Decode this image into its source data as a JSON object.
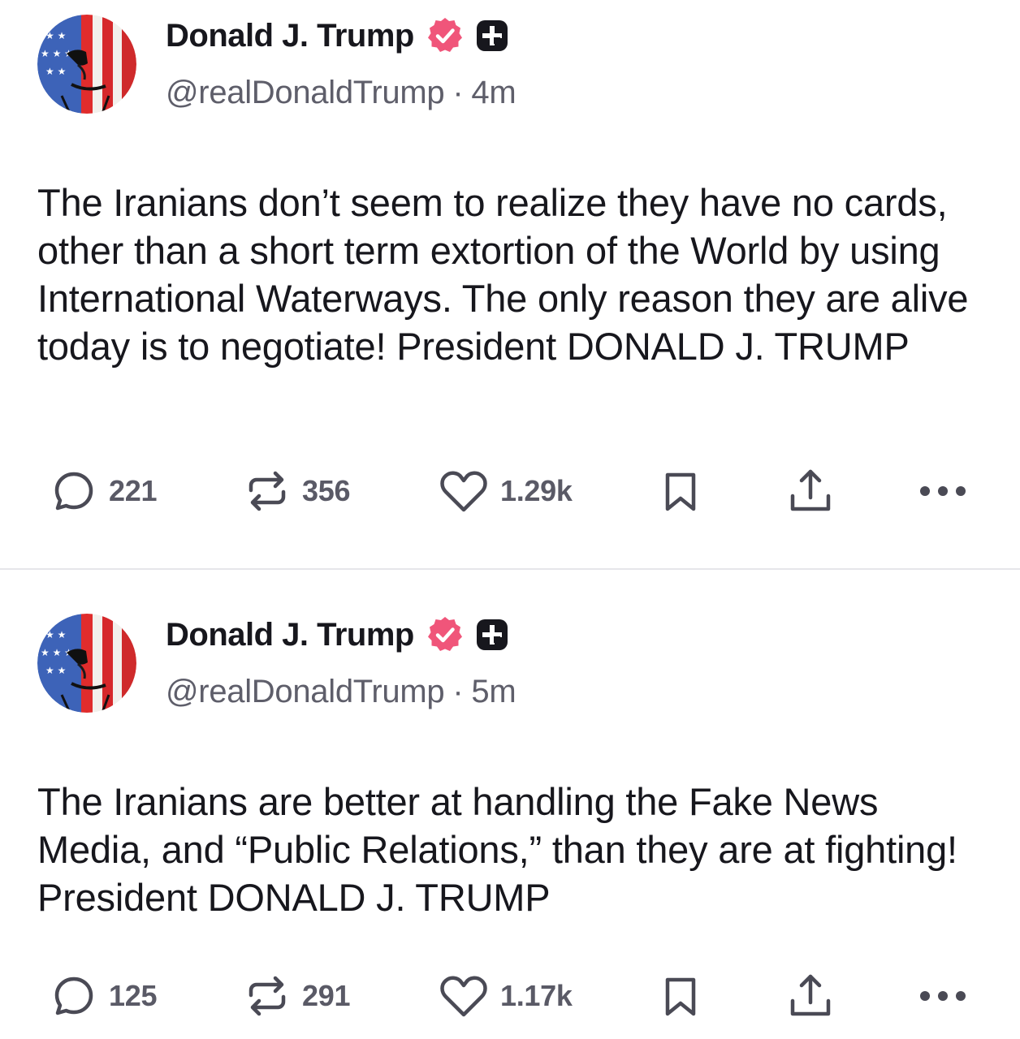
{
  "posts": [
    {
      "author": {
        "display_name": "Donald J. Trump",
        "handle": "@realDonaldTrump",
        "verified_icon": "verified-badge-icon",
        "plus_icon": "plus-badge-icon"
      },
      "separator": "·",
      "time": "4m",
      "text": "The Iranians don’t seem to realize they have no cards, other than a short term extortion of the World by using International Waterways. The only reason they are alive today is to negotiate! President DONALD J. TRUMP",
      "stats": {
        "replies": "221",
        "reposts": "356",
        "likes": "1.29k"
      }
    },
    {
      "author": {
        "display_name": "Donald J. Trump",
        "handle": "@realDonaldTrump",
        "verified_icon": "verified-badge-icon",
        "plus_icon": "plus-badge-icon"
      },
      "separator": "·",
      "time": "5m",
      "text": "The Iranians are better at handling the Fake News Media, and “Public Relations,” than they are at fighting! President DONALD J. TRUMP",
      "stats": {
        "replies": "125",
        "reposts": "291",
        "likes": "1.17k"
      }
    }
  ],
  "icons": [
    "reply-icon",
    "repost-icon",
    "like-icon",
    "bookmark-icon",
    "share-icon",
    "more-icon"
  ],
  "colors": {
    "verified": "#f0557a",
    "text": "#17171d",
    "muted": "#5e5e6a",
    "icon": "#4a4a55",
    "divider": "#e6e6ea"
  }
}
